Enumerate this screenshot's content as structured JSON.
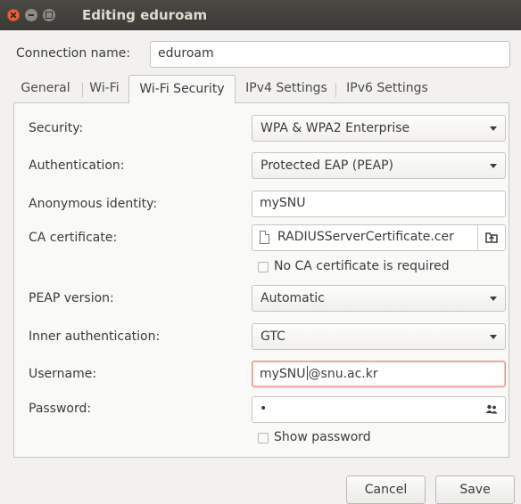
{
  "window": {
    "title": "Editing eduroam"
  },
  "connection": {
    "label": "Connection name:",
    "value": "eduroam"
  },
  "tabs": [
    {
      "label": "General"
    },
    {
      "label": "Wi-Fi"
    },
    {
      "label": "Wi-Fi Security",
      "active": true
    },
    {
      "label": "IPv4 Settings"
    },
    {
      "label": "IPv6 Settings"
    }
  ],
  "form": {
    "security": {
      "label": "Security:",
      "value": "WPA & WPA2 Enterprise"
    },
    "authentication": {
      "label": "Authentication:",
      "value": "Protected EAP (PEAP)"
    },
    "anonymous_identity": {
      "label": "Anonymous identity:",
      "value": "mySNU"
    },
    "ca_certificate": {
      "label": "CA certificate:",
      "value": "RADIUSServerCertificate.cer"
    },
    "no_ca_required": {
      "label": "No CA certificate is required",
      "checked": false
    },
    "peap_version": {
      "label": "PEAP version:",
      "value": "Automatic"
    },
    "inner_auth": {
      "label": "Inner authentication:",
      "value": "GTC"
    },
    "username": {
      "label": "Username:",
      "value_before_caret": "mySNU",
      "value_after_caret": "@snu.ac.kr"
    },
    "password": {
      "label": "Password:",
      "value": "•"
    },
    "show_password": {
      "label": "Show password",
      "checked": false
    }
  },
  "buttons": {
    "cancel": "Cancel",
    "save": "Save"
  },
  "colors": {
    "titlebar": "#3b3a36",
    "close_button": "#e9643a",
    "focus_border": "#e79480"
  }
}
